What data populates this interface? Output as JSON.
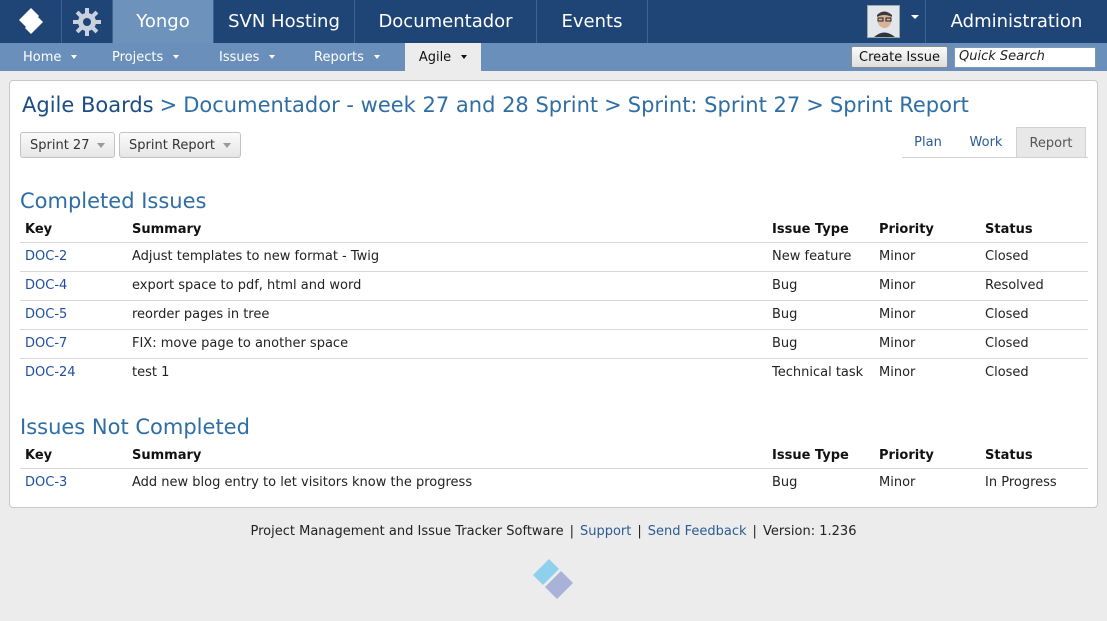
{
  "topbar": {
    "items": [
      {
        "label": "Yongo",
        "active": true
      },
      {
        "label": "SVN Hosting",
        "active": false
      },
      {
        "label": "Documentador",
        "active": false
      },
      {
        "label": "Events",
        "active": false
      }
    ],
    "admin_label": "Administration",
    "logo_icon": "yongo-logo-icon",
    "settings_icon": "gear-icon",
    "colors": {
      "bar": "#1e4576",
      "active": "#6d93bd"
    }
  },
  "subnav": {
    "items": [
      {
        "label": "Home"
      },
      {
        "label": "Projects"
      },
      {
        "label": "Issues"
      },
      {
        "label": "Reports"
      },
      {
        "label": "Agile",
        "active": true
      }
    ],
    "create_issue_label": "Create Issue",
    "search_placeholder": "Quick Search"
  },
  "breadcrumb": {
    "root": "Agile Boards",
    "separator": ">",
    "parts": [
      "Documentador - week 27 and 28 Sprint",
      "Sprint: Sprint 27",
      "Sprint Report"
    ]
  },
  "controls": {
    "sprint_select": "Sprint 27",
    "report_select": "Sprint Report"
  },
  "view_tabs": [
    {
      "label": "Plan",
      "active": false
    },
    {
      "label": "Work",
      "active": false
    },
    {
      "label": "Report",
      "active": true
    }
  ],
  "columns": [
    "Key",
    "Summary",
    "Issue Type",
    "Priority",
    "Status"
  ],
  "completed": {
    "title": "Completed Issues",
    "rows": [
      {
        "key": "DOC-2",
        "summary": "Adjust templates to new format - Twig",
        "type": "New feature",
        "priority": "Minor",
        "status": "Closed"
      },
      {
        "key": "DOC-4",
        "summary": "export space to pdf, html and word",
        "type": "Bug",
        "priority": "Minor",
        "status": "Resolved"
      },
      {
        "key": "DOC-5",
        "summary": "reorder pages in tree",
        "type": "Bug",
        "priority": "Minor",
        "status": "Closed"
      },
      {
        "key": "DOC-7",
        "summary": "FIX: move page to another space",
        "type": "Bug",
        "priority": "Minor",
        "status": "Closed"
      },
      {
        "key": "DOC-24",
        "summary": "test 1",
        "type": "Technical task",
        "priority": "Minor",
        "status": "Closed"
      }
    ]
  },
  "not_completed": {
    "title": "Issues Not Completed",
    "rows": [
      {
        "key": "DOC-3",
        "summary": "Add new blog entry to let visitors know the progress",
        "type": "Bug",
        "priority": "Minor",
        "status": "In Progress"
      }
    ]
  },
  "footer": {
    "text": "Project Management and Issue Tracker Software",
    "separator": "|",
    "support_label": "Support",
    "feedback_label": "Send Feedback",
    "version": "Version: 1.236"
  }
}
